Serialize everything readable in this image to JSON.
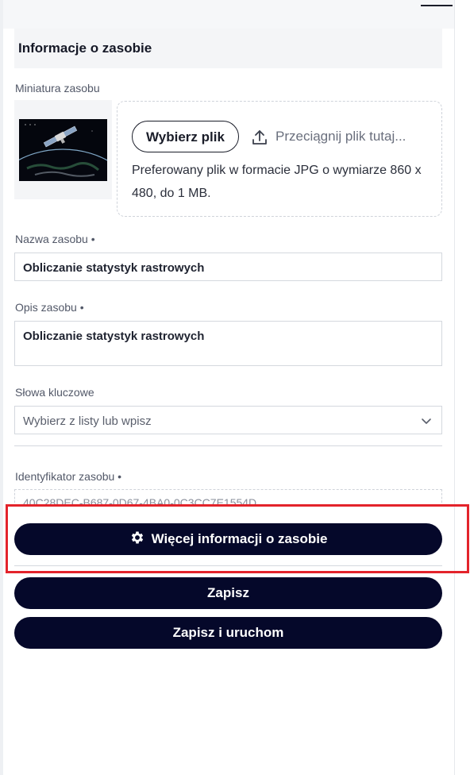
{
  "section": {
    "title": "Informacje o zasobie"
  },
  "thumbnail": {
    "label": "Miniatura zasobu"
  },
  "upload": {
    "choose_label": "Wybierz plik",
    "drop_hint": "Przeciągnij plik tutaj...",
    "note": "Preferowany plik w formacie JPG o wymiarze 860 x 480, do 1 MB."
  },
  "name_field": {
    "label": "Nazwa zasobu •",
    "value": "Obliczanie statystyk rastrowych"
  },
  "description_field": {
    "label": "Opis zasobu •",
    "value": "Obliczanie statystyk rastrowych"
  },
  "keywords_field": {
    "label": "Słowa kluczowe",
    "placeholder": "Wybierz z listy lub wpisz"
  },
  "id_field": {
    "label": "Identyfikator zasobu •",
    "value": "40C28DEC-B687-0D67-4BA0-0C3CC7E1554D"
  },
  "buttons": {
    "more_info": "Więcej informacji o zasobie",
    "save": "Zapisz",
    "save_run": "Zapisz i uruchom"
  },
  "colors": {
    "primary_button": "#05082a",
    "highlight": "#e3232b"
  },
  "icons": {
    "upload": "upload-icon",
    "gear": "gear-icon",
    "chevron": "chevron-down-icon"
  }
}
